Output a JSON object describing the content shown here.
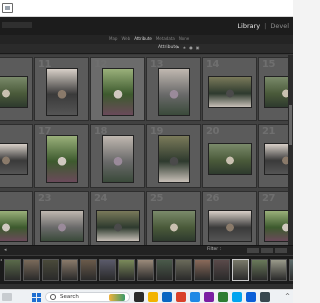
{
  "window": {
    "module_picker": [
      {
        "label": "Library",
        "active": true
      },
      {
        "label": "Devel",
        "active": false
      }
    ],
    "module_separator": "|"
  },
  "menubar": {
    "items": [
      {
        "label": "Map",
        "active": false
      },
      {
        "label": "Web",
        "active": false
      },
      {
        "label": "Attribute",
        "active": true
      },
      {
        "label": "Metadata",
        "active": false
      },
      {
        "label": "None",
        "active": false
      }
    ]
  },
  "filter_bar": {
    "label": "Attribute"
  },
  "grid": {
    "cells": [
      {
        "number": "10",
        "selected": false
      },
      {
        "number": "11",
        "selected": false
      },
      {
        "number": "12",
        "selected": true
      },
      {
        "number": "13",
        "selected": false
      },
      {
        "number": "14",
        "selected": false
      },
      {
        "number": "15",
        "selected": false
      },
      {
        "number": "16",
        "selected": false
      },
      {
        "number": "17",
        "selected": false
      },
      {
        "number": "18",
        "selected": false
      },
      {
        "number": "19",
        "selected": false
      },
      {
        "number": "20",
        "selected": false
      },
      {
        "number": "21",
        "selected": false
      },
      {
        "number": "22",
        "selected": false
      },
      {
        "number": "23",
        "selected": false
      },
      {
        "number": "24",
        "selected": false
      },
      {
        "number": "25",
        "selected": false
      },
      {
        "number": "26",
        "selected": false
      },
      {
        "number": "27",
        "selected": false
      }
    ]
  },
  "filmstrip_bar": {
    "label": "Filter :"
  },
  "taskbar": {
    "search_label": "Search",
    "app_colors": [
      "#2a2a2a",
      "#f2b300",
      "#0a66c2",
      "#d9412b",
      "#1e88e5",
      "#7b1fa2",
      "#2e7d32",
      "#00a4ef",
      "#0b5ed7",
      "#37474f"
    ]
  }
}
